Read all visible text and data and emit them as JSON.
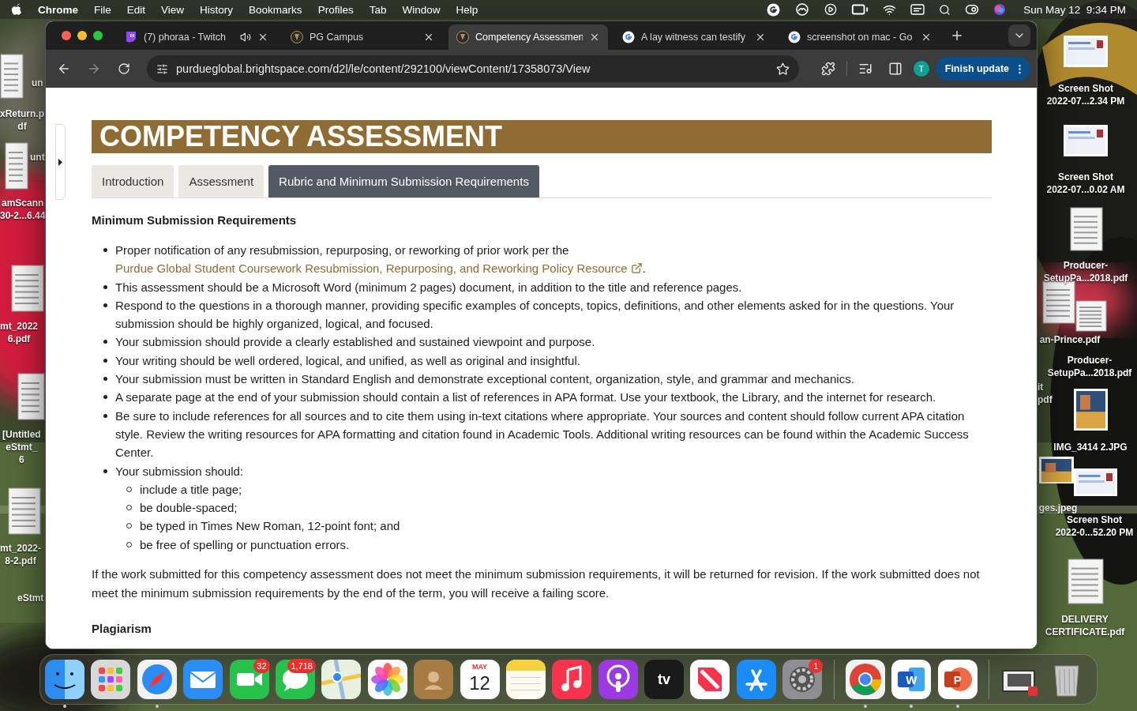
{
  "menu_bar": {
    "app": "Chrome",
    "menus": [
      "File",
      "Edit",
      "View",
      "History",
      "Bookmarks",
      "Profiles",
      "Tab",
      "Window",
      "Help"
    ],
    "clock": "Sun May 12  9:34 PM"
  },
  "desktop": {
    "left_labels": [
      {
        "lines": [
          "un"
        ]
      },
      {
        "lines": [
          "xReturn.p",
          "df"
        ]
      },
      {
        "lines": [
          "unt"
        ]
      },
      {
        "lines": [
          "amScann",
          "30-2...6.44"
        ]
      },
      {
        "lines": [
          "mt_2022",
          "6.pdf"
        ]
      },
      {
        "lines": [
          "[Untitled",
          "eStmt_",
          "6"
        ]
      },
      {
        "lines": [
          "mt_2022-",
          "8-2.pdf"
        ]
      },
      {
        "lines": [
          "eStmt"
        ]
      }
    ],
    "right_labels": [
      {
        "lines": [
          "Screen Shot",
          "2022-07...2.34 PM"
        ]
      },
      {
        "lines": [
          "Screen Shot",
          "2022-07...0.02 AM"
        ]
      },
      {
        "lines": [
          "Producer-",
          "SetupPa...2018.pdf"
        ]
      },
      {
        "lines": [
          "an-Prince.pdf"
        ]
      },
      {
        "lines": [
          "Producer-",
          "SetupPa...2018.pdf"
        ]
      },
      {
        "lines": [
          "it",
          "pdf"
        ]
      },
      {
        "lines": [
          "IMG_3414 2.JPG"
        ]
      },
      {
        "lines": [
          "ges.jpeg"
        ]
      },
      {
        "lines": [
          "Screen Shot",
          "2022-0...52.20 PM"
        ]
      },
      {
        "lines": [
          "DELIVERY",
          "CERTIFICATE.pdf"
        ]
      }
    ]
  },
  "browser": {
    "tabs": [
      {
        "title": "(7) phoraa - Twitch",
        "selected": false,
        "audio": true
      },
      {
        "title": "PG Campus",
        "selected": false,
        "audio": false
      },
      {
        "title": "Competency Assessmen",
        "selected": true,
        "audio": false
      },
      {
        "title": "A lay witness can testify",
        "selected": false,
        "audio": false
      },
      {
        "title": "screenshot on mac - Go",
        "selected": false,
        "audio": false
      }
    ],
    "url": "purdueglobal.brightspace.com/d2l/le/content/292100/viewContent/17358073/View",
    "profile": "T",
    "update_button": "Finish update"
  },
  "page": {
    "banner": "COMPETENCY ASSESSMENT",
    "tabs": [
      {
        "label": "Introduction",
        "selected": false
      },
      {
        "label": "Assessment",
        "selected": false
      },
      {
        "label": "Rubric and Minimum Submission Requirements",
        "selected": true
      }
    ],
    "section_title": "Minimum Submission Requirements",
    "requirements": [
      {
        "text": "Proper notification of any resubmission, repurposing, or reworking of prior work per the ",
        "link": "Purdue Global Student Coursework Resubmission, Repurposing, and Reworking Policy Resource",
        "after": "."
      },
      {
        "text": "This assessment should be a Microsoft Word (minimum 2 pages) document, in addition to the title and reference pages."
      },
      {
        "text": "Respond to the questions in a thorough manner, providing specific examples of concepts, topics, definitions, and other elements asked for in the questions. Your submission should be highly organized, logical, and focused."
      },
      {
        "text": "Your submission should provide a clearly established and sustained viewpoint and purpose."
      },
      {
        "text": "Your writing should be well ordered, logical, and unified, as well as original and insightful."
      },
      {
        "text": "Your submission must be written in Standard English and demonstrate exceptional content, organization, style, and grammar and mechanics."
      },
      {
        "text": "A separate page at the end of your submission should contain a list of references in APA format. Use your textbook, the Library, and the internet for research."
      },
      {
        "text": "Be sure to include references for all sources and to cite them using in-text citations where appropriate. Your sources and content should follow current APA citation style. Review the writing resources for APA formatting and citation found in Academic Tools. Additional writing resources can be found within the Academic Success Center."
      },
      {
        "text": "Your submission should:",
        "children": [
          {
            "text": "include a title page;"
          },
          {
            "text": "be double-spaced;"
          },
          {
            "text": "be typed in Times New Roman, 12-point font; and"
          },
          {
            "text": "be free of spelling or punctuation errors."
          }
        ]
      }
    ],
    "note": "If the work submitted for this competency assessment does not meet the minimum submission requirements, it will be returned for revision. If the work submitted does not meet the minimum submission requirements by the end of the term, you will receive a failing score.",
    "next_heading": "Plagiarism"
  },
  "dock": {
    "apps": [
      {
        "running": true
      },
      {
        "running": false
      },
      {
        "running": true
      },
      {
        "running": false
      },
      {
        "running": false,
        "badge": "32"
      },
      {
        "running": false,
        "badge": "1,718"
      },
      {
        "running": false
      },
      {
        "running": false
      },
      {
        "running": false
      },
      {
        "running": false,
        "month": "MAY",
        "label": "12"
      },
      {
        "running": false
      },
      {
        "running": false
      },
      {
        "running": false
      },
      {
        "running": false,
        "label": "tv"
      },
      {
        "running": false
      },
      {
        "running": false
      },
      {
        "running": false,
        "badge": "1"
      }
    ],
    "recent": [
      {
        "running": true
      },
      {
        "running": true,
        "label": "W"
      },
      {
        "running": true,
        "label": "P"
      }
    ],
    "other": [
      {
        "running": false
      },
      {
        "running": false
      }
    ]
  }
}
